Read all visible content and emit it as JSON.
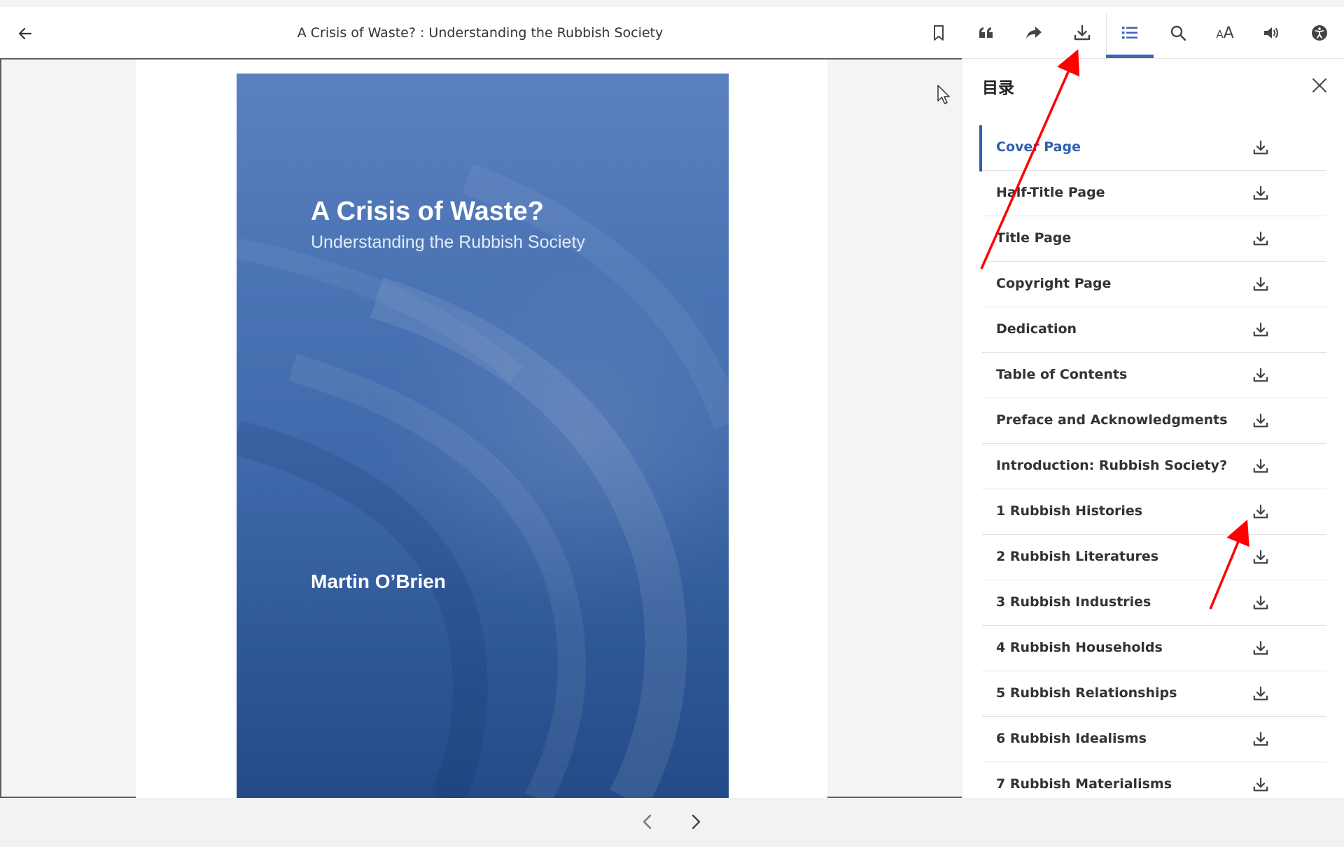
{
  "header": {
    "title": "A Crisis of Waste? : Understanding the Rubbish Society",
    "font_size_small": "A",
    "font_size_large": "A",
    "icons": [
      "back-arrow-icon",
      "bookmark-icon",
      "quote-icon",
      "share-icon",
      "download-icon",
      "toc-list-icon",
      "search-icon",
      "font-size-icon",
      "audio-icon",
      "accessibility-icon"
    ]
  },
  "cover": {
    "title": "A Crisis of Waste?",
    "subtitle": "Understanding the Rubbish Society",
    "author": "Martin O’Brien",
    "colors": {
      "top": "#5a80bf",
      "bottom": "#244b88"
    }
  },
  "toc": {
    "header": "目录",
    "items": [
      {
        "label": "Cover Page",
        "active": true
      },
      {
        "label": "Half-Title Page"
      },
      {
        "label": "Title Page"
      },
      {
        "label": "Copyright Page"
      },
      {
        "label": "Dedication"
      },
      {
        "label": "Table of Contents"
      },
      {
        "label": "Preface and Acknowledgments"
      },
      {
        "label": "Introduction: Rubbish Society?"
      },
      {
        "label": "1 Rubbish Histories"
      },
      {
        "label": "2 Rubbish Literatures"
      },
      {
        "label": "3 Rubbish Industries"
      },
      {
        "label": "4 Rubbish Households"
      },
      {
        "label": "5 Rubbish Relationships"
      },
      {
        "label": "6 Rubbish Idealisms"
      },
      {
        "label": "7 Rubbish Materialisms"
      }
    ]
  },
  "colors": {
    "accent": "#2f5fb0",
    "annotation_arrow": "#ff0000",
    "icon": "#444444"
  }
}
